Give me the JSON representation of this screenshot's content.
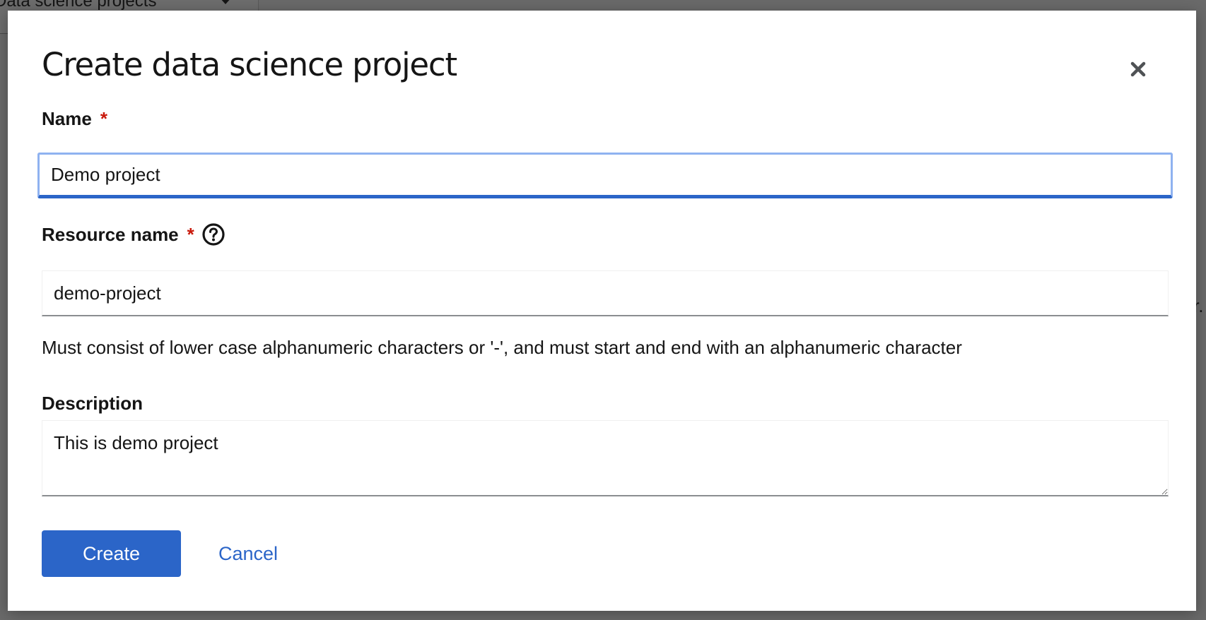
{
  "background": {
    "project_selector_text": "Data science projects",
    "stray_text": "r."
  },
  "modal": {
    "title": "Create data science project",
    "close_icon": "close-icon"
  },
  "form": {
    "name": {
      "label": "Name",
      "required_marker": "*",
      "value": "Demo project"
    },
    "resource_name": {
      "label": "Resource name",
      "required_marker": "*",
      "help_icon": "question-circle-icon",
      "value": "demo-project",
      "helper_text": "Must consist of lower case alphanumeric characters or '-', and must start and end with an alphanumeric character"
    },
    "description": {
      "label": "Description",
      "value": "This is demo project"
    }
  },
  "actions": {
    "create_label": "Create",
    "cancel_label": "Cancel"
  },
  "colors": {
    "primary": "#2b65c8",
    "required": "#c9190b",
    "focus_ring": "#8fb2f0",
    "overlay": "#6a6a6a"
  }
}
